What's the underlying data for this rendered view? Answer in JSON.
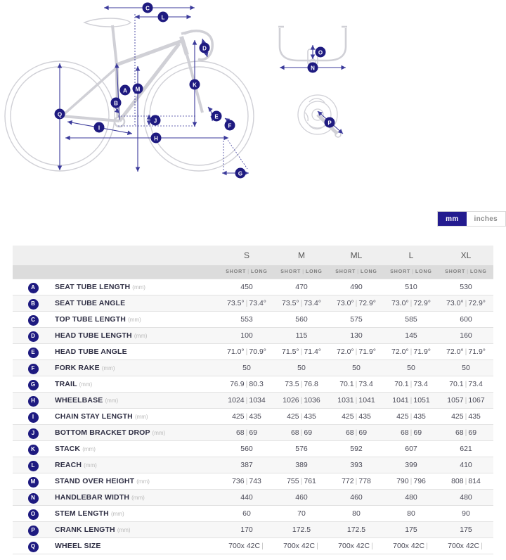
{
  "unit_toggle": {
    "options": [
      {
        "label": "mm",
        "active": true
      },
      {
        "label": "inches",
        "active": false
      }
    ],
    "active_color": "#231b8f"
  },
  "diagram": {
    "accent_color": "#1e1a80",
    "frame_color": "#d2d2d6",
    "markers": [
      {
        "id": "A",
        "meaning": "seat-tube-length"
      },
      {
        "id": "B",
        "meaning": "seat-tube-angle"
      },
      {
        "id": "C",
        "meaning": "top-tube-length"
      },
      {
        "id": "D",
        "meaning": "head-tube-length"
      },
      {
        "id": "E",
        "meaning": "head-tube-angle"
      },
      {
        "id": "F",
        "meaning": "fork-rake"
      },
      {
        "id": "G",
        "meaning": "trail"
      },
      {
        "id": "H",
        "meaning": "wheelbase"
      },
      {
        "id": "I",
        "meaning": "chain-stay-length"
      },
      {
        "id": "J",
        "meaning": "bottom-bracket-drop"
      },
      {
        "id": "K",
        "meaning": "stack"
      },
      {
        "id": "L",
        "meaning": "reach"
      },
      {
        "id": "M",
        "meaning": "stand-over-height"
      },
      {
        "id": "N",
        "meaning": "handlebar-width"
      },
      {
        "id": "O",
        "meaning": "stem-length"
      },
      {
        "id": "P",
        "meaning": "crank-length"
      },
      {
        "id": "Q",
        "meaning": "wheel-size"
      }
    ]
  },
  "table": {
    "sizes": [
      "S",
      "M",
      "ML",
      "L",
      "XL"
    ],
    "sub_headers": {
      "short": "SHORT",
      "long": "LONG",
      "separator": "|"
    },
    "rows": [
      {
        "badge": "A",
        "label": "SEAT TUBE LENGTH",
        "unit": "(mm)",
        "values": [
          "450",
          "470",
          "490",
          "510",
          "530"
        ]
      },
      {
        "badge": "B",
        "label": "SEAT TUBE ANGLE",
        "unit": "",
        "values": [
          "73.5° | 73.4°",
          "73.5° | 73.4°",
          "73.0° | 72.9°",
          "73.0° | 72.9°",
          "73.0° | 72.9°"
        ]
      },
      {
        "badge": "C",
        "label": "TOP TUBE LENGTH",
        "unit": "(mm)",
        "values": [
          "553",
          "560",
          "575",
          "585",
          "600"
        ]
      },
      {
        "badge": "D",
        "label": "HEAD TUBE LENGTH",
        "unit": "(mm)",
        "values": [
          "100",
          "115",
          "130",
          "145",
          "160"
        ]
      },
      {
        "badge": "E",
        "label": "HEAD TUBE ANGLE",
        "unit": "",
        "values": [
          "71.0° | 70.9°",
          "71.5° | 71.4°",
          "72.0° | 71.9°",
          "72.0° | 71.9°",
          "72.0° | 71.9°"
        ]
      },
      {
        "badge": "F",
        "label": "FORK RAKE",
        "unit": "(mm)",
        "values": [
          "50",
          "50",
          "50",
          "50",
          "50"
        ]
      },
      {
        "badge": "G",
        "label": "TRAIL",
        "unit": "(mm)",
        "values": [
          "76.9 | 80.3",
          "73.5 | 76.8",
          "70.1 | 73.4",
          "70.1 | 73.4",
          "70.1 | 73.4"
        ]
      },
      {
        "badge": "H",
        "label": "WHEELBASE",
        "unit": "(mm)",
        "values": [
          "1024 | 1034",
          "1026 | 1036",
          "1031 | 1041",
          "1041 | 1051",
          "1057 | 1067"
        ]
      },
      {
        "badge": "I",
        "label": "CHAIN STAY LENGTH",
        "unit": "(mm)",
        "values": [
          "425 | 435",
          "425 | 435",
          "425 | 435",
          "425 | 435",
          "425 | 435"
        ]
      },
      {
        "badge": "J",
        "label": "BOTTOM BRACKET DROP",
        "unit": "(mm)",
        "values": [
          "68 | 69",
          "68 | 69",
          "68 | 69",
          "68 | 69",
          "68 | 69"
        ]
      },
      {
        "badge": "K",
        "label": "STACK",
        "unit": "(mm)",
        "values": [
          "560",
          "576",
          "592",
          "607",
          "621"
        ]
      },
      {
        "badge": "L",
        "label": "REACH",
        "unit": "(mm)",
        "values": [
          "387",
          "389",
          "393",
          "399",
          "410"
        ]
      },
      {
        "badge": "M",
        "label": "STAND OVER HEIGHT",
        "unit": "(mm)",
        "values": [
          "736 | 743",
          "755 | 761",
          "772 | 778",
          "790 | 796",
          "808 | 814"
        ]
      },
      {
        "badge": "N",
        "label": "HANDLEBAR WIDTH",
        "unit": "(mm)",
        "values": [
          "440",
          "460",
          "460",
          "480",
          "480"
        ]
      },
      {
        "badge": "O",
        "label": "STEM LENGTH",
        "unit": "(mm)",
        "values": [
          "60",
          "70",
          "80",
          "80",
          "90"
        ]
      },
      {
        "badge": "P",
        "label": "CRANK LENGTH",
        "unit": "(mm)",
        "values": [
          "170",
          "172.5",
          "172.5",
          "175",
          "175"
        ]
      },
      {
        "badge": "Q",
        "label": "WHEEL SIZE",
        "unit": "",
        "values": [
          "700x 42C |",
          "700x 42C |",
          "700x 42C |",
          "700x 42C |",
          "700x 42C |"
        ]
      }
    ]
  }
}
